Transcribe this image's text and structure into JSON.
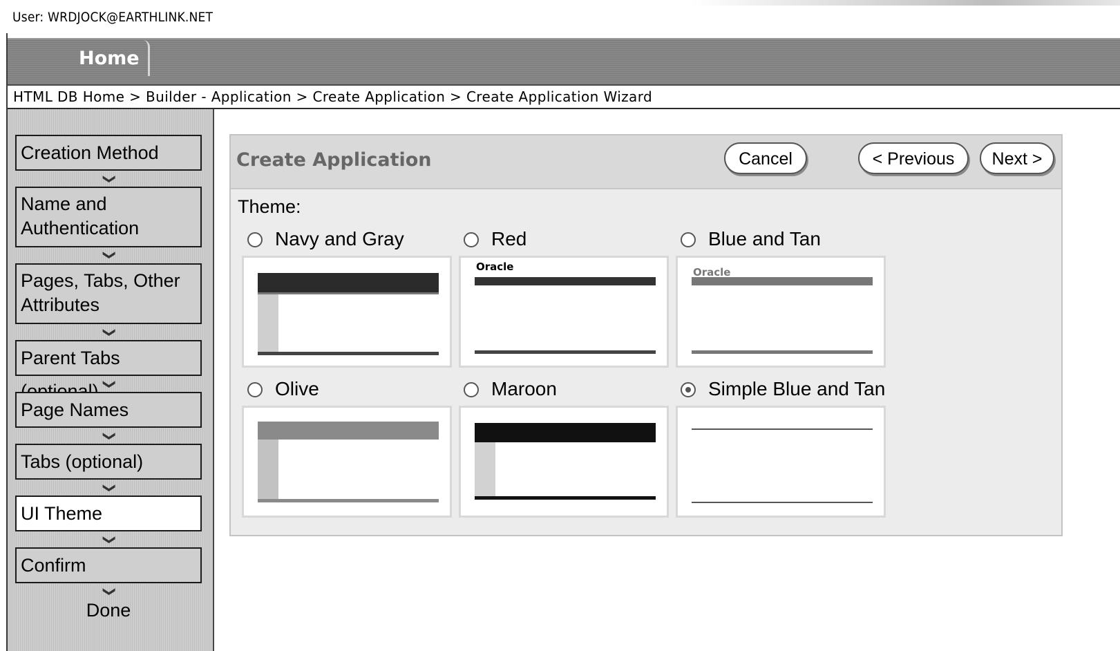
{
  "user": {
    "label": "User: WRDJOCK@EARTHLINK.NET"
  },
  "tabs": {
    "home": "Home"
  },
  "breadcrumb": {
    "text": "HTML DB Home > Builder - Application  > Create Application > Create Application Wizard"
  },
  "wizard_steps": [
    {
      "label": "Creation Method",
      "active": false
    },
    {
      "label": "Name and Authentication",
      "active": false
    },
    {
      "label": "Pages, Tabs, Other Attributes",
      "active": false
    },
    {
      "label": "Parent Tabs (optional)",
      "active": false
    },
    {
      "label": "Page Names",
      "active": false
    },
    {
      "label": "Tabs (optional)",
      "active": false
    },
    {
      "label": "UI Theme",
      "active": true
    },
    {
      "label": "Confirm",
      "active": false
    }
  ],
  "done_label": "Done",
  "panel": {
    "title": "Create Application",
    "cancel_label": "Cancel",
    "previous_label": "< Previous",
    "next_label": "Next >",
    "theme_label": "Theme:"
  },
  "themes": [
    {
      "name": "Navy and Gray",
      "selected": false,
      "thumb_logo": ""
    },
    {
      "name": "Red",
      "selected": false,
      "thumb_logo": "Oracle"
    },
    {
      "name": "Blue and Tan",
      "selected": false,
      "thumb_logo": "Oracle"
    },
    {
      "name": "Olive",
      "selected": false,
      "thumb_logo": ""
    },
    {
      "name": "Maroon",
      "selected": false,
      "thumb_logo": ""
    },
    {
      "name": "Simple Blue and Tan",
      "selected": true,
      "thumb_logo": ""
    }
  ],
  "icons": {
    "step_arrow": "chevron-down-icon",
    "radio": "radio-button"
  }
}
